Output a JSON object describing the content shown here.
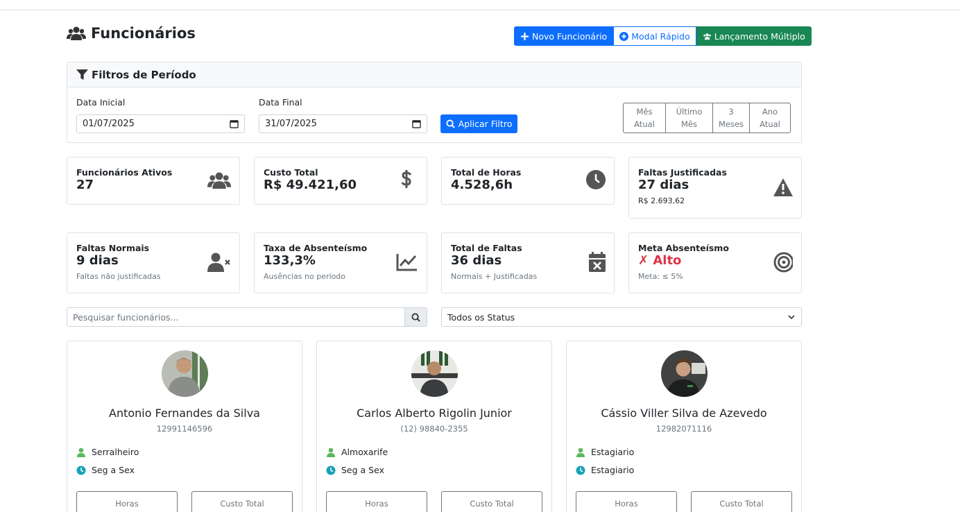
{
  "header": {
    "title": "Funcionários",
    "buttons": {
      "new": "Novo Funcionário",
      "modal": "Modal Rápido",
      "multi": "Lançamento Múltiplo"
    }
  },
  "filters": {
    "title": "Filtros de Período",
    "start_label": "Data Inicial",
    "start_value": "01/07/2025",
    "end_label": "Data Final",
    "end_value": "31/07/2025",
    "apply_label": "Aplicar Filtro",
    "periods": [
      {
        "line1": "Mês",
        "line2": "Atual"
      },
      {
        "line1": "Último",
        "line2": "Mês"
      },
      {
        "line1": "3",
        "line2": "Meses"
      },
      {
        "line1": "Ano",
        "line2": "Atual"
      }
    ]
  },
  "stats": [
    {
      "label": "Funcionários Ativos",
      "value": "27",
      "icon": "users-icon"
    },
    {
      "label": "Custo Total",
      "value": "R$ 49.421,60",
      "icon": "dollar-icon"
    },
    {
      "label": "Total de Horas",
      "value": "4.528,6h",
      "icon": "clock-icon"
    },
    {
      "label": "Faltas Justificadas",
      "value": "27 dias",
      "sub": "R$ 2.693,62",
      "icon": "warning-icon"
    },
    {
      "label": "Faltas Normais",
      "value": "9 dias",
      "sub": "Faltas não justificadas",
      "icon": "user-x-icon"
    },
    {
      "label": "Taxa de Absenteísmo",
      "value": "133,3%",
      "sub": "Ausências no período",
      "icon": "chart-line-icon"
    },
    {
      "label": "Total de Faltas",
      "value": "36 dias",
      "sub": "Normais + Justificadas",
      "icon": "calendar-x-icon"
    },
    {
      "label": "Meta Absenteísmo",
      "value": "✗ Alto",
      "sub": "Meta: ≤ 5%",
      "icon": "target-icon"
    }
  ],
  "search": {
    "placeholder": "Pesquisar funcionários..."
  },
  "status_filter": {
    "selected": "Todos os Status"
  },
  "employees": [
    {
      "name": "Antonio Fernandes da Silva",
      "phone": "12991146596",
      "role": "Serralheiro",
      "schedule": "Seg a Sex",
      "hours_label": "Horas",
      "cost_label": "Custo Total"
    },
    {
      "name": "Carlos Alberto Rigolin Junior",
      "phone": "(12) 98840-2355",
      "role": "Almoxarife",
      "schedule": "Seg a Sex",
      "hours_label": "Horas",
      "cost_label": "Custo Total"
    },
    {
      "name": "Cássio Viller Silva de Azevedo",
      "phone": "12982071116",
      "role": "Estagiario",
      "schedule": "Estagiario",
      "hours_label": "Horas",
      "cost_label": "Custo Total"
    }
  ],
  "colors": {
    "primary": "#0d6efd",
    "success": "#198754",
    "danger": "#dc3545",
    "green_icon": "#5cb85c",
    "teal_icon": "#17a2b8"
  }
}
